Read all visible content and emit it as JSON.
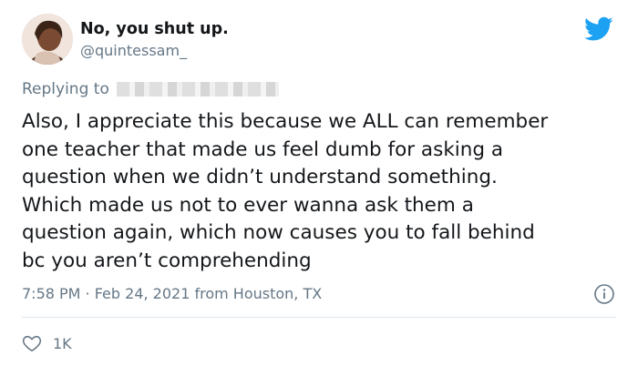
{
  "tweet": {
    "display_name": "No, you shut up.",
    "handle": "@quintessam_",
    "replying_label": "Replying to",
    "text": "Also, I appreciate this because we ALL can remember\none teacher that made us feel dumb for asking a\nquestion when we didn’t understand something.\nWhich made us not to ever wanna ask them a\nquestion again, which now causes you to fall behind\nbc you aren’t comprehending",
    "timestamp": "7:58 PM · Feb 24, 2021 from Houston, TX",
    "like_count": "1K"
  },
  "colors": {
    "twitter_blue": "#1da1f2",
    "secondary_text": "#657786",
    "primary_text": "#14171a"
  },
  "icons": {
    "brand": "twitter-bird-icon",
    "info": "info-icon",
    "like": "heart-icon"
  }
}
